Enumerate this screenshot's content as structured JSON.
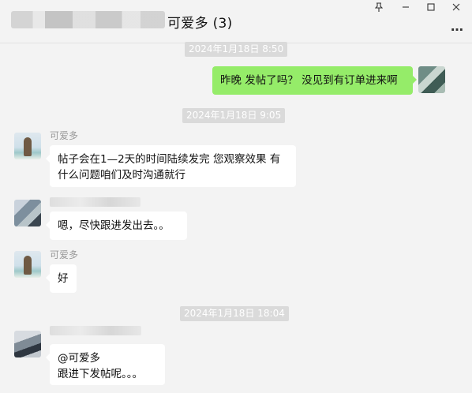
{
  "window": {
    "title": "可爱多 (3)",
    "controls": {
      "pin": "⁀",
      "minimize": "–",
      "maximize": "□",
      "close": "✕"
    },
    "more": "…"
  },
  "messages": {
    "t1": "2024年1月18日 8:50",
    "m1": {
      "text": "昨晚 发帖了吗？ 没见到有订单进来啊"
    },
    "t2": "2024年1月18日 9:05",
    "m2": {
      "sender": "可爱多",
      "lines": [
        "帖子会在1—2天的时间陆续发完 您观察效果 有",
        "什么问题咱们及时沟通就行"
      ]
    },
    "m3": {
      "text": "嗯，尽快跟进发出去。。"
    },
    "m4": {
      "sender": "可爱多",
      "text": "好"
    },
    "t3": "2024年1月18日 18:04",
    "m5": {
      "lines": [
        "@可爱多",
        "跟进下发帖呢。。。"
      ]
    }
  },
  "colors": {
    "background": "#f3f3f3",
    "sent_bubble": "#95ec69",
    "received_bubble": "#ffffff",
    "timestamp_bg": "#dadada"
  }
}
